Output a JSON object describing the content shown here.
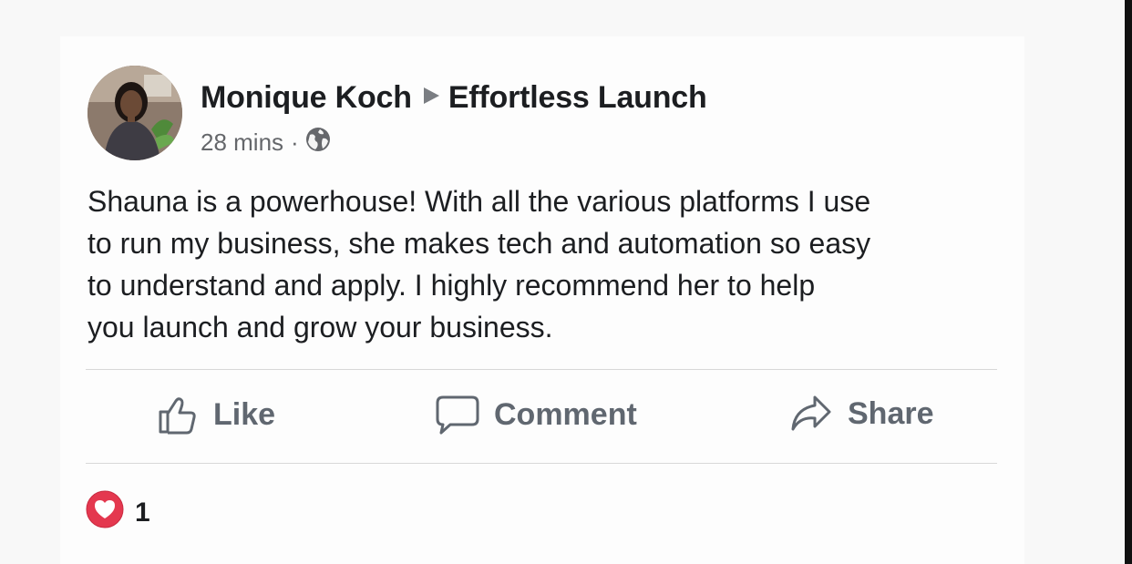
{
  "post": {
    "author": "Monique Koch",
    "arrow_icon": "triangle-right-icon",
    "group": "Effortless Launch",
    "time": "28 mins",
    "separator": "·",
    "privacy_icon": "globe-icon",
    "lines": [
      "Shauna is a powerhouse! With all the various platforms I use",
      "to run my business, she makes tech and automation so easy",
      "to understand and apply. I highly recommend her to help",
      "you launch and grow your business."
    ]
  },
  "actions": {
    "like_label": "Like",
    "comment_label": "Comment",
    "share_label": "Share",
    "like_icon": "thumbs-up-icon",
    "comment_icon": "comment-bubble-icon",
    "share_icon": "share-arrow-icon"
  },
  "reactions": {
    "icon": "heart-reaction-icon",
    "count": "1"
  },
  "colors": {
    "text_primary": "#1c1e21",
    "text_secondary": "#65676b",
    "action_text": "#606770",
    "heart_red": "#e4384f",
    "divider": "#d8d8d8"
  }
}
